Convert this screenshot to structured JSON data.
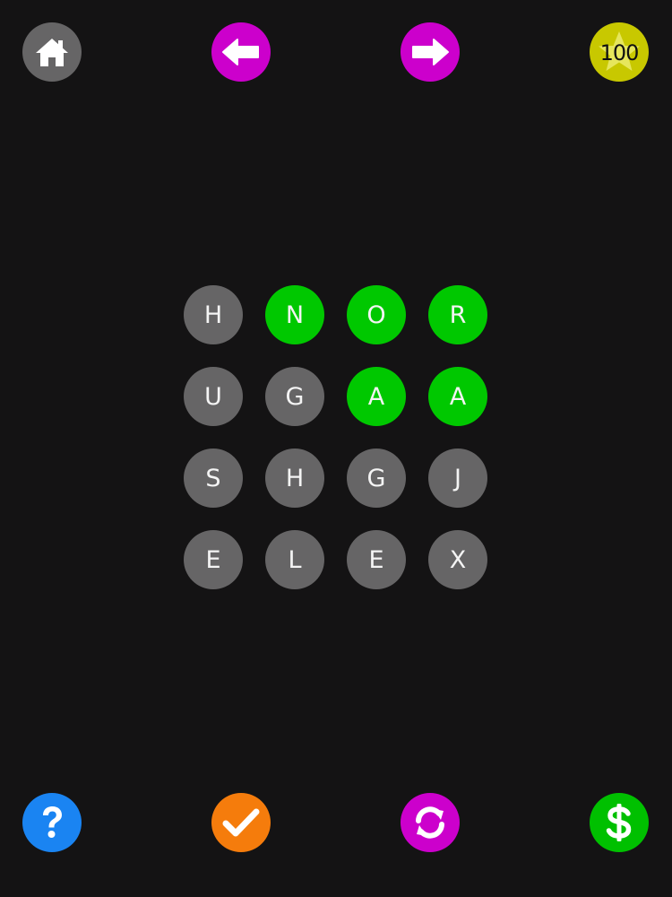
{
  "colors": {
    "background": "#141314",
    "tile_default": "#666566",
    "tile_selected": "#00c800",
    "nav_gray": "#666566",
    "nav_magenta": "#cc00cc",
    "score_yellow": "#c8c800",
    "help_blue": "#1a84f2",
    "check_orange": "#f57c0c",
    "refresh_magenta": "#cc00cc",
    "coins_green": "#00c000"
  },
  "toolbar_top": {
    "home_icon": "home-icon",
    "back_icon": "arrow-left-icon",
    "forward_icon": "arrow-right-icon",
    "score": "100",
    "score_icon": "star-icon"
  },
  "grid": {
    "rows": [
      [
        {
          "letter": "H",
          "selected": false
        },
        {
          "letter": "N",
          "selected": true
        },
        {
          "letter": "O",
          "selected": true
        },
        {
          "letter": "R",
          "selected": true
        }
      ],
      [
        {
          "letter": "U",
          "selected": false
        },
        {
          "letter": "G",
          "selected": false
        },
        {
          "letter": "A",
          "selected": true
        },
        {
          "letter": "A",
          "selected": true
        }
      ],
      [
        {
          "letter": "S",
          "selected": false
        },
        {
          "letter": "H",
          "selected": false
        },
        {
          "letter": "G",
          "selected": false
        },
        {
          "letter": "J",
          "selected": false
        }
      ],
      [
        {
          "letter": "E",
          "selected": false
        },
        {
          "letter": "L",
          "selected": false
        },
        {
          "letter": "E",
          "selected": false
        },
        {
          "letter": "X",
          "selected": false
        }
      ]
    ]
  },
  "toolbar_bottom": {
    "help_icon": "question-mark-icon",
    "submit_icon": "checkmark-icon",
    "shuffle_icon": "refresh-icon",
    "store_icon": "dollar-icon"
  }
}
